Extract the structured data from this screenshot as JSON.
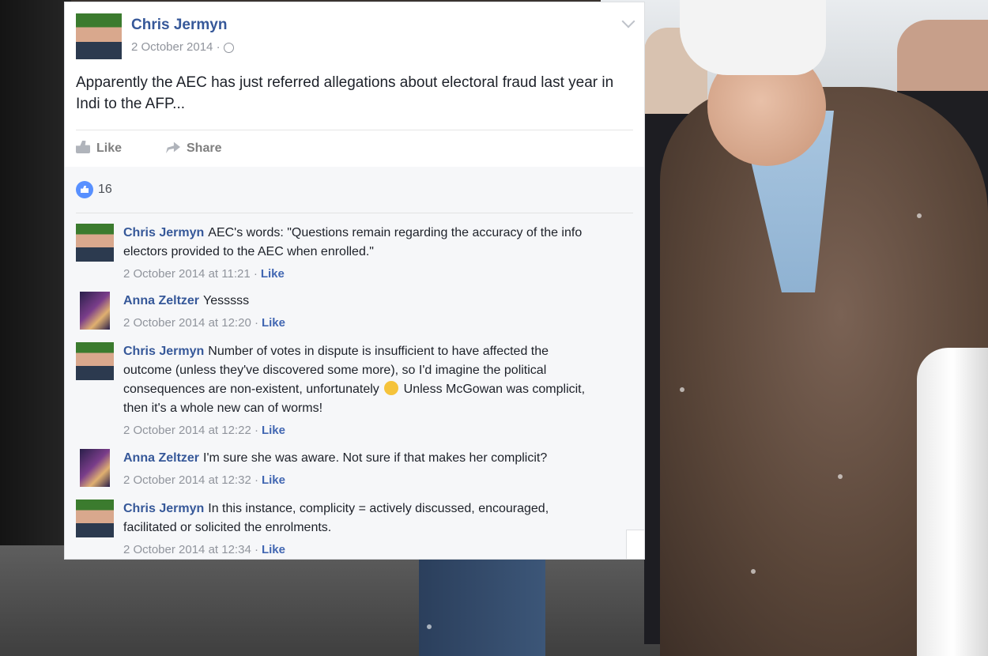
{
  "post": {
    "author": "Chris Jermyn",
    "date": "2 October 2014 ·",
    "text": "Apparently the AEC has just referred allegations about electoral fraud last year in Indi to the AFP...",
    "like_label": "Like",
    "share_label": "Share",
    "reaction_count": "16"
  },
  "comments": [
    {
      "author": "Chris Jermyn",
      "text": "AEC's words: \"Questions remain regarding the accuracy of the info electors provided to the AEC when enrolled.\"",
      "time": "2 October 2014 at 11:21 ·",
      "like": "Like"
    },
    {
      "author": "Anna Zeltzer",
      "text": "Yesssss",
      "time": "2 October 2014 at 12:20 ·",
      "like": "Like"
    },
    {
      "author": "Chris Jermyn",
      "text": "Number of votes in dispute is insufficient to have affected the outcome (unless they've discovered some more), so I'd imagine the political consequences are non-existent, unfortunately",
      "text_after_emoji": "Unless McGowan was complicit, then it's a whole new can of worms!",
      "time": "2 October 2014 at 12:22 ·",
      "like": "Like"
    },
    {
      "author": "Anna Zeltzer",
      "text": "I'm sure she was aware. Not sure if that makes her complicit?",
      "time": "2 October 2014 at 12:32 ·",
      "like": "Like"
    },
    {
      "author": "Chris Jermyn",
      "text": "In this instance, complicity = actively discussed, encouraged, facilitated or solicited the enrolments.",
      "time": "2 October 2014 at 12:34 ·",
      "like": "Like"
    }
  ],
  "colors": {
    "link_blue": "#365899",
    "like_blue": "#5890ff",
    "meta_gray": "#90949c"
  },
  "icons": [
    "chevron-down-icon",
    "globe-icon",
    "thumb-icon",
    "share-icon",
    "like-bubble-icon",
    "emoji-icon"
  ]
}
